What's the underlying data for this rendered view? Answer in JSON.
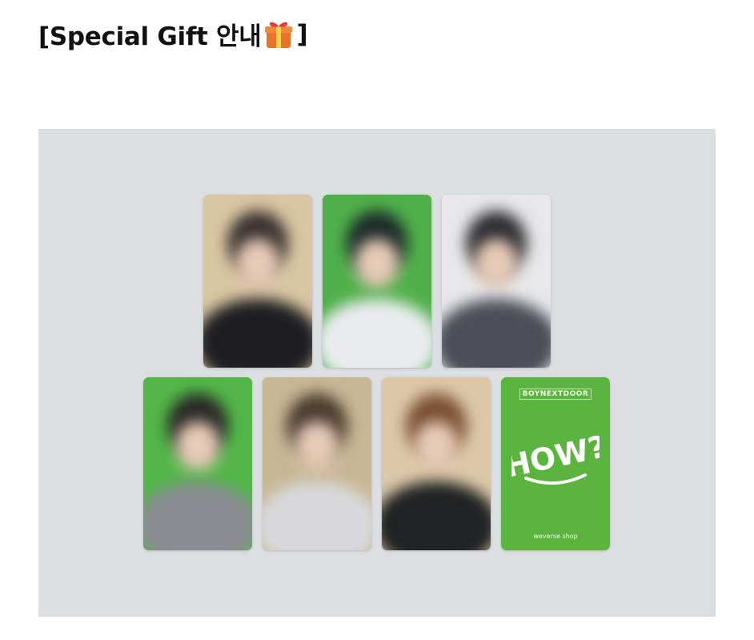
{
  "header": {
    "title_prefix": "[Special Gift 안내",
    "title_icon": "gift-icon",
    "title_suffix": "]"
  },
  "photocards": [
    {
      "name": "photocard-1",
      "background": "#d9c6a2",
      "top_color": "#3a3330",
      "body_color": "#1e1e22"
    },
    {
      "name": "photocard-2",
      "background": "#4fb04a",
      "top_color": "#1f2a2a",
      "body_color": "#e9ecef"
    },
    {
      "name": "photocard-3",
      "background": "#e8e8ea",
      "top_color": "#2d2d30",
      "body_color": "#4c4f55"
    },
    {
      "name": "photocard-4",
      "background": "#52b748",
      "top_color": "#2c2828",
      "body_color": "#8a8d92"
    },
    {
      "name": "photocard-5",
      "background": "#c7b795",
      "top_color": "#4a3b2e",
      "body_color": "#d8d8dc"
    },
    {
      "name": "photocard-6",
      "background": "#dcc8a8",
      "top_color": "#7a4f33",
      "body_color": "#202224"
    }
  ],
  "logo_card": {
    "top_text": "BOYNEXTDOOR",
    "art_text": "HOW?",
    "bottom_text": "weverse shop",
    "background": "#5bb43d"
  }
}
